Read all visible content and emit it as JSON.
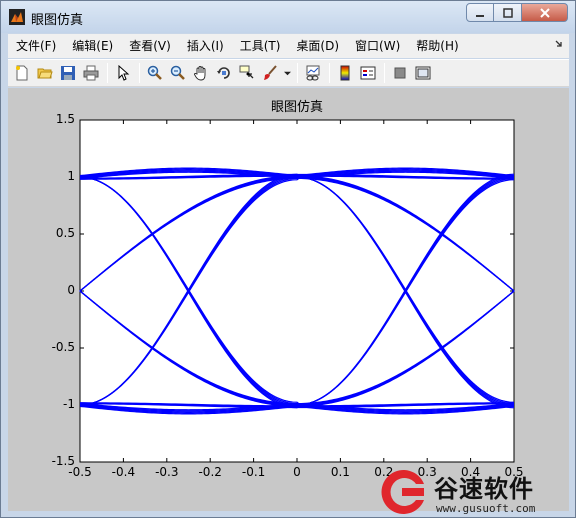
{
  "window": {
    "title": "眼图仿真",
    "icon": "matlab-figure-icon"
  },
  "menu": [
    "文件(F)",
    "编辑(E)",
    "查看(V)",
    "插入(I)",
    "工具(T)",
    "桌面(D)",
    "窗口(W)",
    "帮助(H)"
  ],
  "toolbar": {
    "buttons": [
      "new-figure",
      "open",
      "save",
      "print",
      "select-pointer",
      "zoom-in",
      "zoom-out",
      "pan",
      "rotate-3d",
      "data-cursor",
      "brush",
      "link-plot",
      "colorbar",
      "legend",
      "hide-plot-tools",
      "show-plot-tools"
    ]
  },
  "chart_data": {
    "type": "line",
    "title": "眼图仿真",
    "xlabel": "",
    "ylabel": "",
    "xlim": [
      -0.5,
      0.5
    ],
    "ylim": [
      -1.5,
      1.5
    ],
    "xticks": [
      "-0.5",
      "-0.4",
      "-0.3",
      "-0.2",
      "-0.1",
      "0",
      "0.1",
      "0.2",
      "0.3",
      "0.4",
      "0.5"
    ],
    "yticks": [
      "1.5",
      "1",
      "0.5",
      "0",
      "-0.5",
      "-1",
      "-1.5"
    ],
    "color": "#0000ff",
    "grid": false,
    "description_of_traces": "eye diagram: overlapping raised-cosine transitions between levels -1 and 1",
    "sample_traces": [
      {
        "x": [
          -0.5,
          -0.25,
          0,
          0.25,
          0.5
        ],
        "y": [
          -1,
          -0.02,
          1,
          1.03,
          1
        ]
      },
      {
        "x": [
          -0.5,
          -0.25,
          0,
          0.25,
          0.5
        ],
        "y": [
          1,
          0.02,
          -1,
          -1.03,
          -1
        ]
      },
      {
        "x": [
          -0.5,
          -0.25,
          0,
          0.25,
          0.5
        ],
        "y": [
          0,
          0.72,
          1,
          0.72,
          0
        ]
      },
      {
        "x": [
          -0.5,
          -0.25,
          0,
          0.25,
          0.5
        ],
        "y": [
          0,
          -0.72,
          -1,
          -0.72,
          0
        ]
      },
      {
        "x": [
          -0.5,
          -0.15,
          0,
          0.15,
          0.5
        ],
        "y": [
          1,
          1.06,
          1,
          1.06,
          1
        ]
      },
      {
        "x": [
          -0.5,
          -0.15,
          0,
          0.15,
          0.5
        ],
        "y": [
          -1,
          -1.06,
          -1,
          -1.06,
          -1
        ]
      }
    ]
  },
  "watermark": {
    "name": "谷速软件",
    "url": "www.gusuoft.com",
    "color": "#e0262c"
  }
}
